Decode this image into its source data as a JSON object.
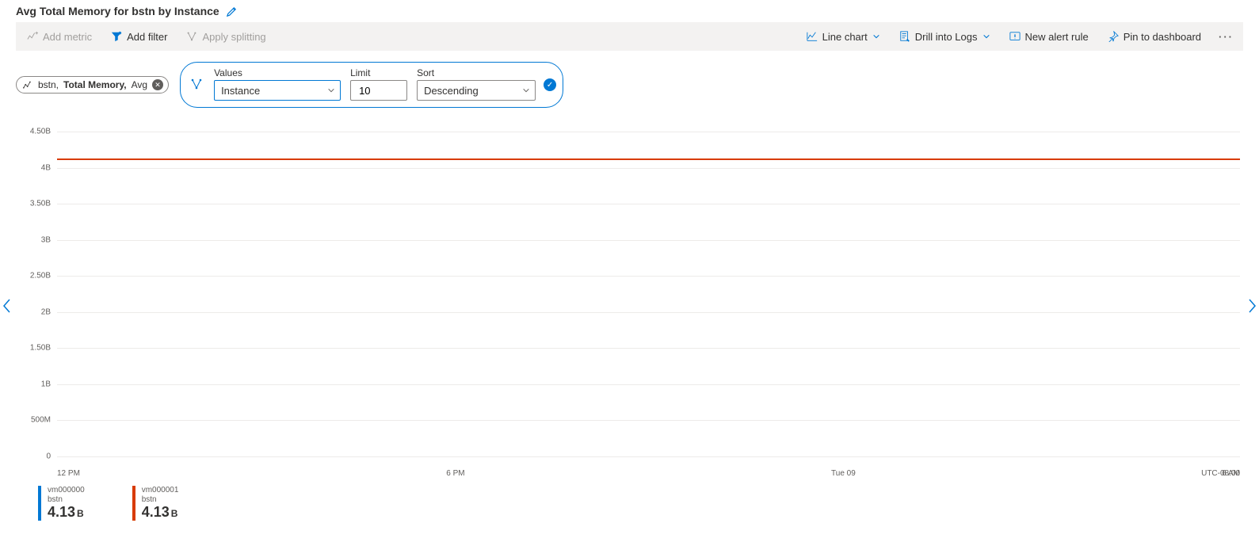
{
  "title": "Avg Total Memory for bstn by Instance",
  "toolbar": {
    "add_metric": "Add metric",
    "add_filter": "Add filter",
    "apply_splitting": "Apply splitting",
    "line_chart": "Line chart",
    "drill_logs": "Drill into Logs",
    "new_alert": "New alert rule",
    "pin_dashboard": "Pin to dashboard"
  },
  "metric_pill": {
    "resource": "bstn,",
    "metric": "Total Memory,",
    "aggregation": "Avg"
  },
  "split": {
    "values_label": "Values",
    "values_selected": "Instance",
    "limit_label": "Limit",
    "limit_value": "10",
    "sort_label": "Sort",
    "sort_selected": "Descending"
  },
  "chart_data": {
    "type": "line",
    "title": "Avg Total Memory for bstn by Instance",
    "ylabel": "",
    "xlabel": "",
    "ylim": [
      0,
      4500000000
    ],
    "y_ticks": [
      "4.50B",
      "4B",
      "3.50B",
      "3B",
      "2.50B",
      "2B",
      "1.50B",
      "1B",
      "500M",
      "0"
    ],
    "x_ticks": [
      "12 PM",
      "6 PM",
      "Tue 09",
      "6 AM"
    ],
    "timezone": "UTC-08:00",
    "x": [
      "12 PM",
      "6 PM",
      "Tue 09",
      "6 AM"
    ],
    "series": [
      {
        "name": "vm000000",
        "resource": "bstn",
        "color": "#0078d4",
        "values": [
          4130000000,
          4130000000,
          4130000000,
          4130000000
        ],
        "display_value": "4.13",
        "display_unit": "B"
      },
      {
        "name": "vm000001",
        "resource": "bstn",
        "color": "#d83b01",
        "values": [
          4130000000,
          4130000000,
          4130000000,
          4130000000
        ],
        "display_value": "4.13",
        "display_unit": "B"
      }
    ]
  }
}
